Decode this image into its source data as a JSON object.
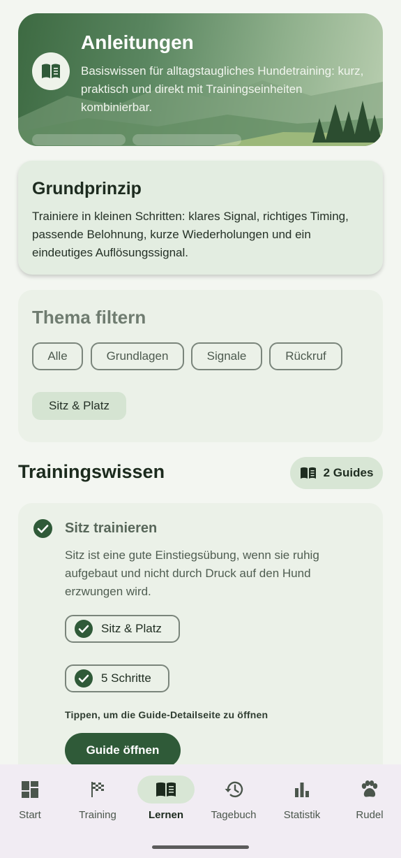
{
  "hero": {
    "title": "Anleitungen",
    "description": "Basiswissen für alltagstaugliches Hundetraining: kurz, praktisch und direkt mit Trainingseinheiten kombinierbar.",
    "icon": "book-open-icon"
  },
  "principle": {
    "title": "Grundprinzip",
    "text": "Trainiere in kleinen Schritten: klares Signal, richtiges Timing, passende Belohnung, kurze Wiederholungen und ein eindeutiges Auflösungssignal."
  },
  "filter": {
    "title": "Thema filtern",
    "chips": [
      "Alle",
      "Grundlagen",
      "Signale",
      "Rückruf",
      "Sitz & Platz"
    ],
    "selected": "Sitz & Platz"
  },
  "section": {
    "title": "Trainingswissen",
    "badge": "2 Guides"
  },
  "guide": {
    "title": "Sitz trainieren",
    "description": "Sitz ist eine gute Einstiegsübung, wenn sie ruhig aufgebaut und nicht durch Druck auf den Hund erzwungen wird.",
    "tags": [
      "Sitz & Platz",
      "5 Schritte"
    ],
    "hint": "Tippen, um die Guide-Detailseite zu öffnen",
    "button": "Guide öffnen"
  },
  "nav": {
    "items": [
      {
        "label": "Start",
        "icon": "dashboard-icon"
      },
      {
        "label": "Training",
        "icon": "checkered-flag-icon"
      },
      {
        "label": "Lernen",
        "icon": "book-open-icon"
      },
      {
        "label": "Tagebuch",
        "icon": "history-icon"
      },
      {
        "label": "Statistik",
        "icon": "bar-chart-icon"
      },
      {
        "label": "Rudel",
        "icon": "paw-icon"
      }
    ],
    "active": "Lernen"
  },
  "colors": {
    "accent": "#2f5a38",
    "selected_chip": "#d5e4d2",
    "background": "#f3f6f1"
  }
}
